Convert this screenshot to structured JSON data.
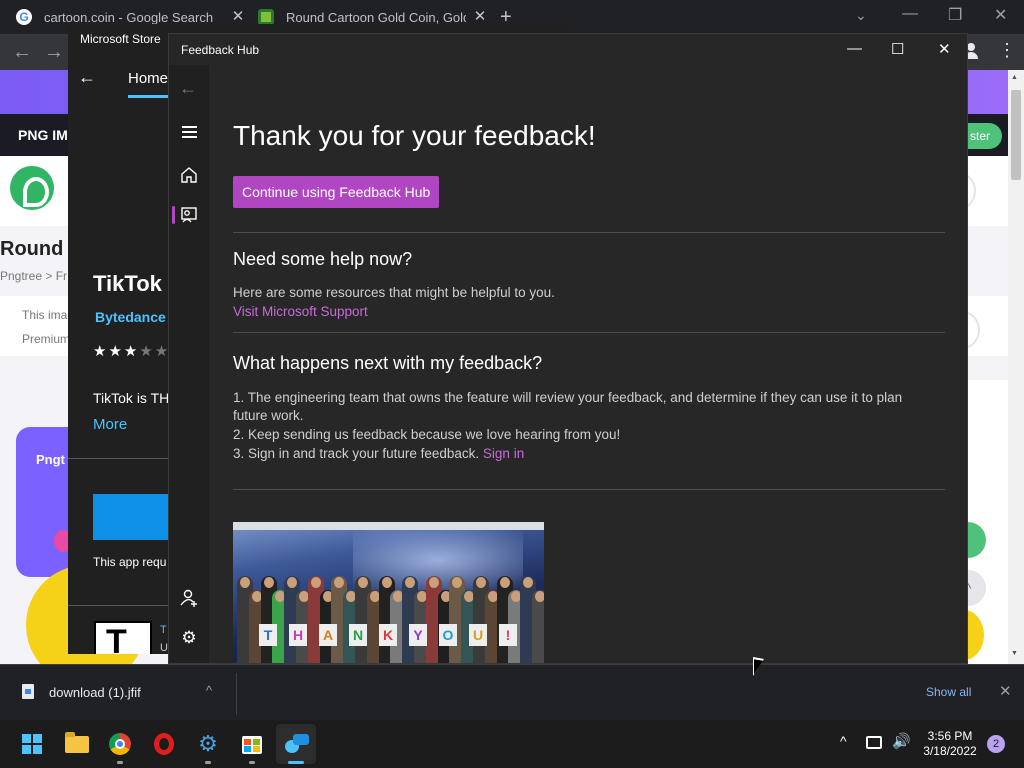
{
  "chrome": {
    "tabs": [
      {
        "title": "cartoon.coin - Google Search",
        "icon": "google-favicon"
      },
      {
        "title": "Round Cartoon Gold Coin, Gold",
        "icon": "pngtree-favicon"
      }
    ],
    "new_tab": "+",
    "window_controls": {
      "minimize": "—",
      "restore": "❐",
      "close": "✕",
      "chevron": "⌄"
    },
    "nav": {
      "back": "←",
      "forward": "→",
      "menu": "⋮"
    }
  },
  "webpage": {
    "nav_title": "PNG IM",
    "register_label": "ster",
    "heading": "Round",
    "breadcrumb": "Pngtree >  Fr",
    "card_line1": "This ima",
    "card_line2": "Premium",
    "preview_label": "Pngt",
    "up_arrow": "^"
  },
  "store": {
    "title": "Microsoft Store",
    "back": "←",
    "home_tab": "Home",
    "app_name": "TikTok",
    "publisher": "Bytedance",
    "rating_filled": "★★★",
    "rating_empty": "★★",
    "description": "TikTok is TH",
    "more_label": "More",
    "requirement": "This app requ",
    "esrb_line1": "T",
    "esrb_line2": "U"
  },
  "feedback_hub": {
    "title": "Feedback Hub",
    "controls": {
      "minimize": "—",
      "maximize": "☐",
      "close": "✕"
    },
    "rail": {
      "back": "←",
      "settings": "⚙"
    },
    "heading": "Thank you for your feedback!",
    "continue_button": "Continue using Feedback Hub",
    "help": {
      "title": "Need some help now?",
      "text": "Here are some resources that might be helpful to you.",
      "link": "Visit Microsoft Support"
    },
    "next": {
      "title": "What happens next with my feedback?",
      "item1a": "1. The engineering team that owns the feature will review your feedback, and determine if they can use it to plan",
      "item1b": "future work.",
      "item2": "2. Keep sending us feedback because we love hearing from you!",
      "item3": "3. Sign in and track your future feedback.",
      "sign_in": "Sign in"
    },
    "photo_signs": [
      "T",
      "H",
      "A",
      "N",
      "K",
      "Y",
      "O",
      "U",
      "!"
    ]
  },
  "downloads": {
    "file_name": "download (1).jfif",
    "chevron": "^",
    "show_all": "Show all",
    "close": "✕"
  },
  "taskbar": {
    "tray_chevron": "^",
    "volume": "🔊",
    "time": "3:56 PM",
    "date": "3/18/2022",
    "notifications": "2",
    "settings_glyph": "⚙"
  }
}
